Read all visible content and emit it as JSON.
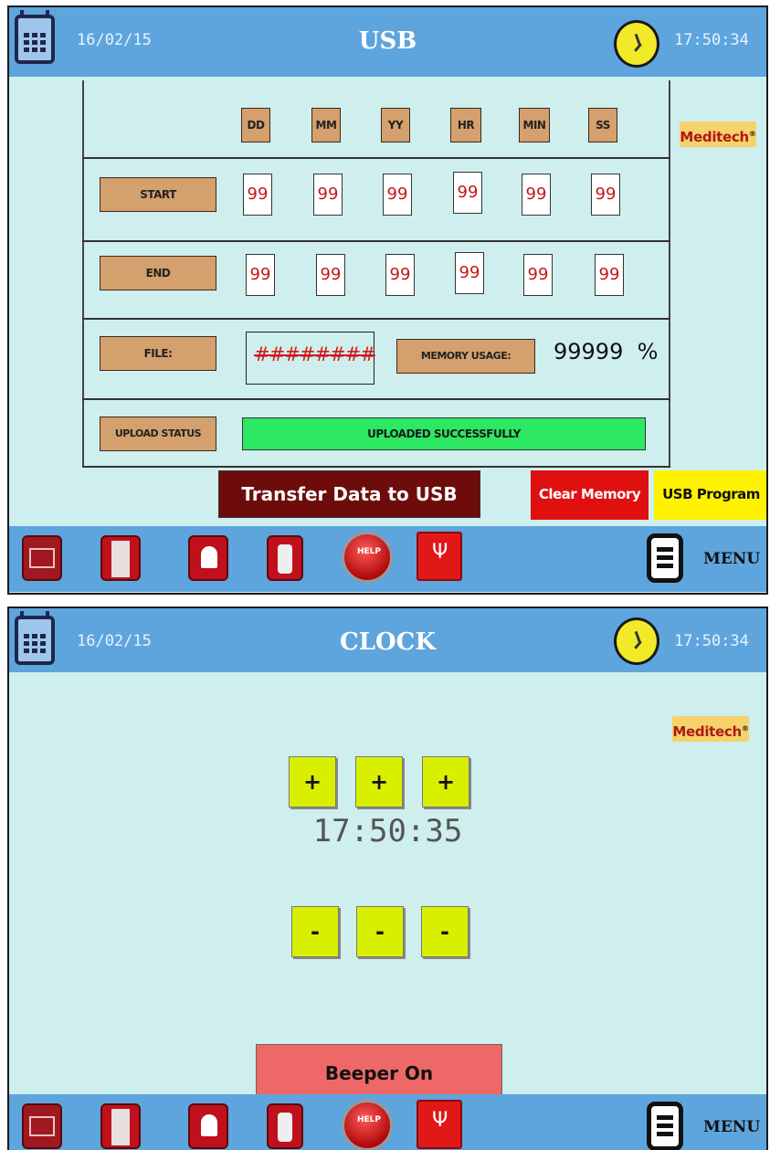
{
  "colors": {
    "header_blue": "#5ea5de",
    "screen_bg": "#cfeeee",
    "tan": "#d4a06e",
    "value_red": "#c21818",
    "status_green": "#2de862",
    "transfer_maroon": "#6e0c0c",
    "clear_red": "#e01010",
    "usb_yellow": "#fff200",
    "adjust_lime": "#d8f000",
    "beeper_pink": "#ef6868"
  },
  "usb_screen": {
    "header": {
      "date": "16/02/15",
      "title": "USB",
      "time": "17:50:34"
    },
    "logo": {
      "text": "Meditech",
      "mark": "®"
    },
    "columns": [
      "DD",
      "MM",
      "YY",
      "HR",
      "MIN",
      "SS"
    ],
    "start": {
      "label": "START",
      "values": [
        "99",
        "99",
        "99",
        "99",
        "99",
        "99"
      ]
    },
    "end": {
      "label": "END",
      "values": [
        "99",
        "99",
        "99",
        "99",
        "99",
        "99"
      ]
    },
    "file": {
      "label": "FILE:",
      "value": "########"
    },
    "memory": {
      "label": "MEMORY USAGE:",
      "value": "99999",
      "unit": "%"
    },
    "upload": {
      "label": "UPLOAD STATUS",
      "status": "UPLOADED SUCCESSFULLY"
    },
    "buttons": {
      "transfer": "Transfer Data to USB",
      "clear": "Clear Memory",
      "usb_program": "USB Program"
    },
    "footer": {
      "menu_label": "MENU",
      "help_text": "HELP"
    },
    "icons": [
      "graph-icon",
      "film-icon",
      "bell-icon",
      "phone-icon",
      "help-icon",
      "usb-icon",
      "menu-icon"
    ]
  },
  "clock_screen": {
    "header": {
      "date": "16/02/15",
      "title": "CLOCK",
      "time": "17:50:34"
    },
    "logo": {
      "text": "Meditech",
      "mark": "®"
    },
    "plus_labels": [
      "+",
      "+",
      "+"
    ],
    "minus_labels": [
      "-",
      "-",
      "-"
    ],
    "clock_value": "17:50:35",
    "beeper_label": "Beeper On",
    "footer": {
      "menu_label": "MENU",
      "help_text": "HELP"
    }
  }
}
